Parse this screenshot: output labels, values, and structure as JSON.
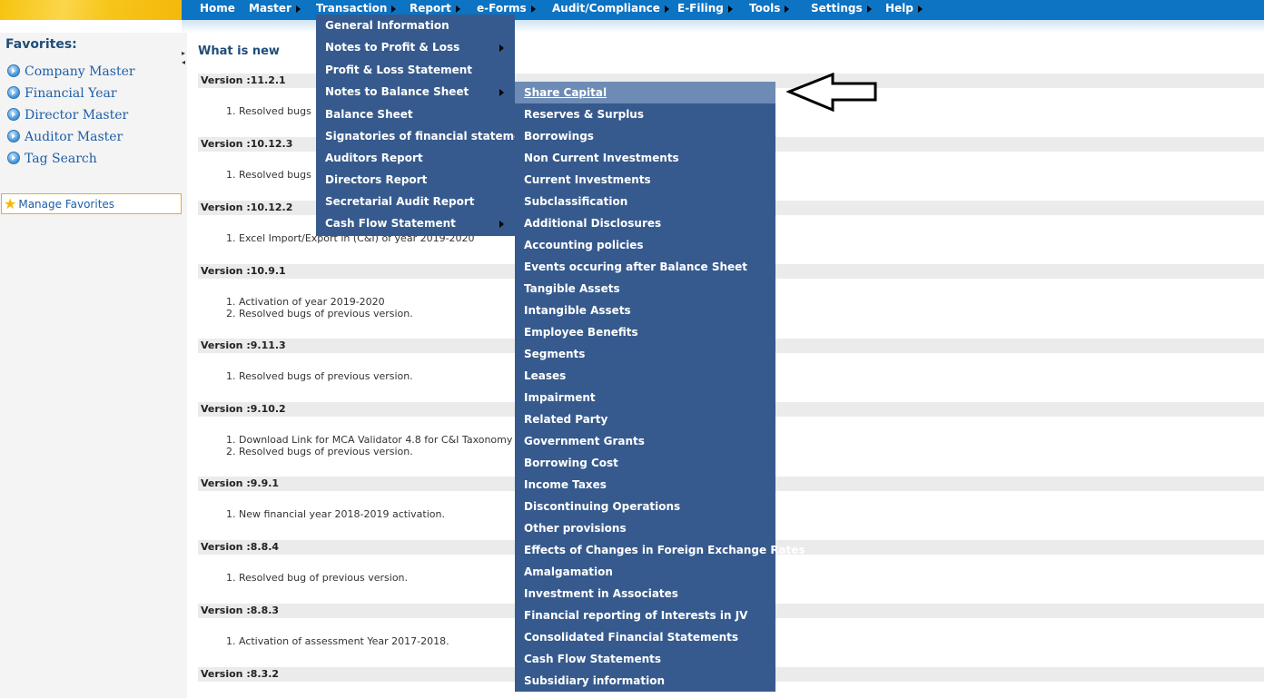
{
  "menubar": {
    "items": [
      {
        "label": "Home",
        "arrow": false
      },
      {
        "label": "Master",
        "arrow": true
      },
      {
        "label": "Transaction",
        "arrow": true
      },
      {
        "label": "Report",
        "arrow": true
      },
      {
        "label": "e-Forms",
        "arrow": true
      },
      {
        "label": "Audit/Compliance",
        "arrow": true
      },
      {
        "label": "E-Filing",
        "arrow": true
      },
      {
        "label": "Tools",
        "arrow": true
      },
      {
        "label": "Settings",
        "arrow": true
      },
      {
        "label": "Help",
        "arrow": true
      }
    ]
  },
  "sidebar": {
    "title": "Favorites:",
    "items": [
      "Company Master",
      "Financial Year",
      "Director Master",
      "Auditor Master",
      "Tag Search"
    ],
    "manage_label": "Manage Favorites"
  },
  "main": {
    "heading": "What is new",
    "versions": [
      {
        "label": "Version :11.2.1",
        "notes": [
          "1. Resolved bugs"
        ]
      },
      {
        "label": "Version :10.12.3",
        "notes": [
          "1. Resolved bugs"
        ]
      },
      {
        "label": "Version :10.12.2",
        "notes": [
          "1. Excel Import/Export in (C&I) of year 2019-2020"
        ]
      },
      {
        "label": "Version :10.9.1",
        "notes": [
          "1. Activation of year 2019-2020",
          "2. Resolved bugs of previous version."
        ]
      },
      {
        "label": "Version :9.11.3",
        "notes": [
          "1. Resolved bugs of previous version."
        ]
      },
      {
        "label": "Version :9.10.2",
        "notes": [
          "1. Download Link for MCA Validator 4.8 for C&I Taxonomy",
          "2. Resolved bugs of previous version."
        ]
      },
      {
        "label": "Version :9.9.1",
        "notes": [
          "1. New financial year 2018-2019 activation."
        ]
      },
      {
        "label": "Version :8.8.4",
        "notes": [
          "1. Resolved bug of previous version."
        ]
      },
      {
        "label": "Version :8.8.3",
        "notes": [
          "1. Activation of assessment Year 2017-2018."
        ]
      },
      {
        "label": "Version :8.3.2",
        "notes": []
      }
    ]
  },
  "transaction_menu": {
    "items": [
      {
        "label": "General Information",
        "submenu": false
      },
      {
        "label": "Notes to Profit & Loss",
        "submenu": true
      },
      {
        "label": "Profit & Loss Statement",
        "submenu": false
      },
      {
        "label": "Notes to Balance Sheet",
        "submenu": true
      },
      {
        "label": "Balance Sheet",
        "submenu": false
      },
      {
        "label": "Signatories of financial statements",
        "submenu": false
      },
      {
        "label": "Auditors Report",
        "submenu": false
      },
      {
        "label": "Directors Report",
        "submenu": false
      },
      {
        "label": "Secretarial Audit Report",
        "submenu": false
      },
      {
        "label": "Cash Flow Statement",
        "submenu": true
      }
    ]
  },
  "balance_sheet_submenu": {
    "items": [
      "Share Capital",
      "Reserves & Surplus",
      "Borrowings",
      "Non Current Investments",
      "Current Investments",
      "Subclassification",
      "Additional Disclosures",
      "Accounting policies",
      "Events occuring after Balance Sheet",
      "Tangible Assets",
      "Intangible Assets",
      "Employee Benefits",
      "Segments",
      "Leases",
      "Impairment",
      "Related Party",
      "Government Grants",
      "Borrowing Cost",
      "Income Taxes",
      "Discontinuing Operations",
      "Other provisions",
      "Effects of Changes in Foreign Exchange Rates",
      "Amalgamation",
      "Investment in Associates",
      "Financial reporting of Interests in JV",
      "Consolidated Financial Statements",
      "Cash Flow Statements",
      "Subsidiary information"
    ],
    "highlighted": "Share Capital"
  },
  "colors": {
    "menubar": "#0d73c3",
    "dropdown": "#365a8d",
    "highlight": "#6d8bb5",
    "logo": "#f6c30e"
  },
  "icons": {
    "pointer": "outline-left-arrow-icon",
    "favorite": "circle-arrow-icon",
    "manage": "star-icon"
  }
}
